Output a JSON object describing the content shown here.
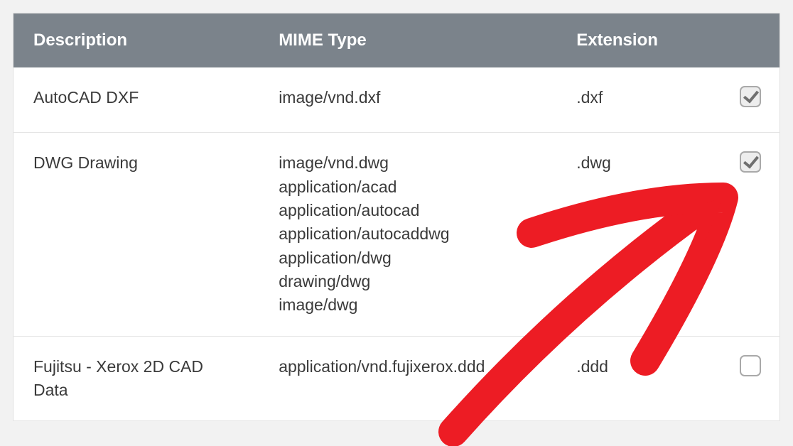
{
  "headers": {
    "description": "Description",
    "mime": "MIME Type",
    "extension": "Extension"
  },
  "rows": [
    {
      "description": "AutoCAD DXF",
      "mimes": [
        "image/vnd.dxf"
      ],
      "extension": ".dxf",
      "checked": true
    },
    {
      "description": "DWG Drawing",
      "mimes": [
        "image/vnd.dwg",
        "application/acad",
        "application/autocad",
        "application/autocaddwg",
        "application/dwg",
        "drawing/dwg",
        "image/dwg"
      ],
      "extension": ".dwg",
      "checked": true
    },
    {
      "description": "Fujitsu - Xerox 2D CAD Data",
      "mimes": [
        "application/vnd.fujixerox.ddd"
      ],
      "extension": ".ddd",
      "checked": false
    }
  ],
  "annotation": {
    "color": "#ed1c24"
  }
}
